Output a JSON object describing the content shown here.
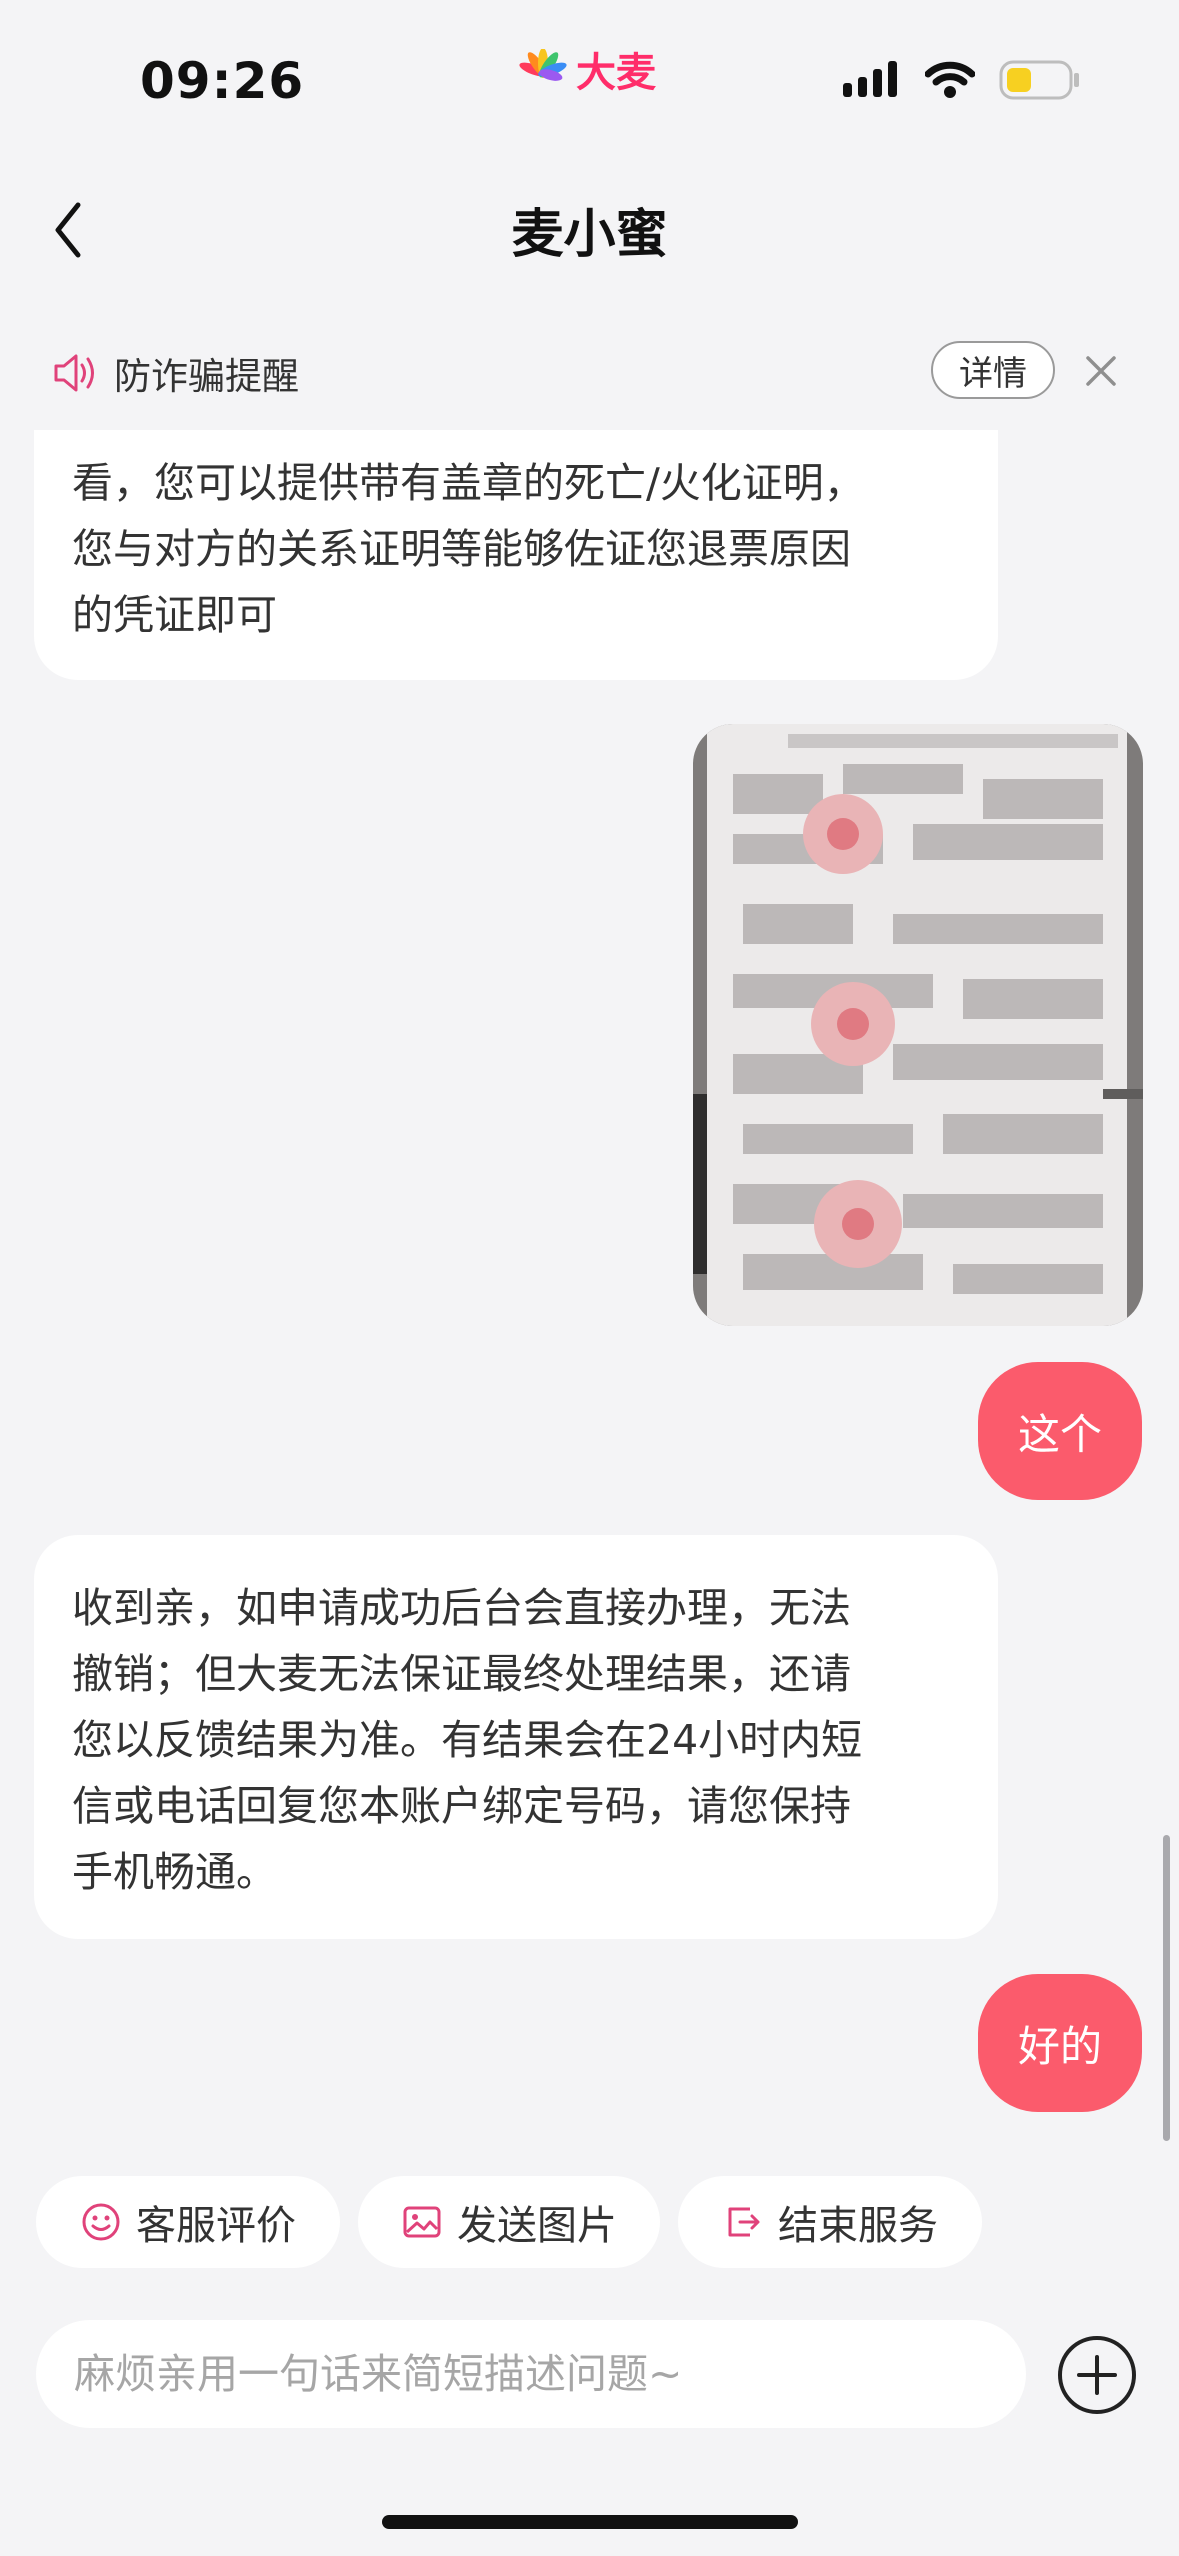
{
  "status_bar": {
    "time": "09:26",
    "brand": "大麦"
  },
  "nav": {
    "title": "麦小蜜"
  },
  "fraud_banner": {
    "text": "防诈骗提醒",
    "details_label": "详情"
  },
  "messages": [
    {
      "role": "agent",
      "lines": [
        "看，您可以提供带有盖章的死亡/火化证明，",
        "您与对方的关系证明等能够佐证您退票原因",
        "的凭证即可"
      ]
    },
    {
      "role": "user",
      "type": "image",
      "content": "pixelated-certificate-photo"
    },
    {
      "role": "user",
      "text": "这个"
    },
    {
      "role": "agent",
      "lines": [
        "收到亲，如申请成功后台会直接办理，无法",
        "撤销；但大麦无法保证最终处理结果，还请",
        "您以反馈结果为准。有结果会在24小时内短",
        "信或电话回复您本账户绑定号码，请您保持",
        "手机畅通。"
      ]
    },
    {
      "role": "user",
      "text": "好的"
    }
  ],
  "quick_actions": [
    {
      "label": "客服评价",
      "icon": "smiley-icon"
    },
    {
      "label": "发送图片",
      "icon": "image-icon"
    },
    {
      "label": "结束服务",
      "icon": "exit-icon"
    }
  ],
  "input": {
    "placeholder": "麻烦亲用一句话来简短描述问题~",
    "value": ""
  },
  "colors": {
    "accent": "#fb5b6c",
    "brand": "#ff2d6a",
    "background": "#f4f4f6",
    "battery": "#f7d021"
  }
}
